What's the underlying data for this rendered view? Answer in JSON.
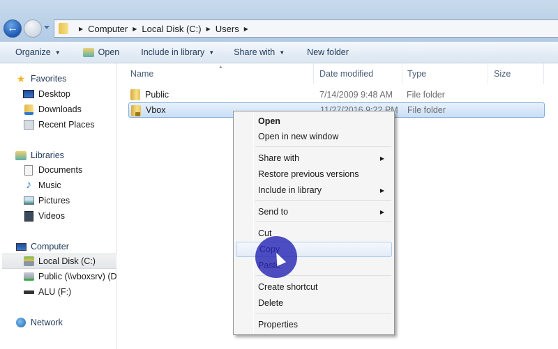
{
  "address_bar": {
    "crumbs": [
      "Computer",
      "Local Disk (C:)",
      "Users"
    ]
  },
  "command_bar": {
    "organize": "Organize",
    "open": "Open",
    "include_in_library": "Include in library",
    "share_with": "Share with",
    "new_folder": "New folder"
  },
  "sidebar": {
    "favorites": "Favorites",
    "favorites_items": [
      "Desktop",
      "Downloads",
      "Recent Places"
    ],
    "libraries": "Libraries",
    "libraries_items": [
      "Documents",
      "Music",
      "Pictures",
      "Videos"
    ],
    "computer": "Computer",
    "computer_items": [
      "Local Disk (C:)",
      "Public (\\\\vboxsrv) (D",
      "ALU (F:)"
    ],
    "network": "Network"
  },
  "file_list": {
    "columns": [
      "Name",
      "Date modified",
      "Type",
      "Size"
    ],
    "rows": [
      {
        "name": "Public",
        "date": "7/14/2009 9:48 AM",
        "type": "File folder",
        "size": ""
      },
      {
        "name": "Vbox",
        "date": "11/27/2016 9:22 PM",
        "type": "File folder",
        "size": ""
      }
    ]
  },
  "context_menu": {
    "items": [
      "Open",
      "Open in new window",
      "Share with",
      "Restore previous versions",
      "Include in library",
      "Send to",
      "Cut",
      "Copy",
      "Paste",
      "Create shortcut",
      "Delete",
      "Properties"
    ]
  }
}
